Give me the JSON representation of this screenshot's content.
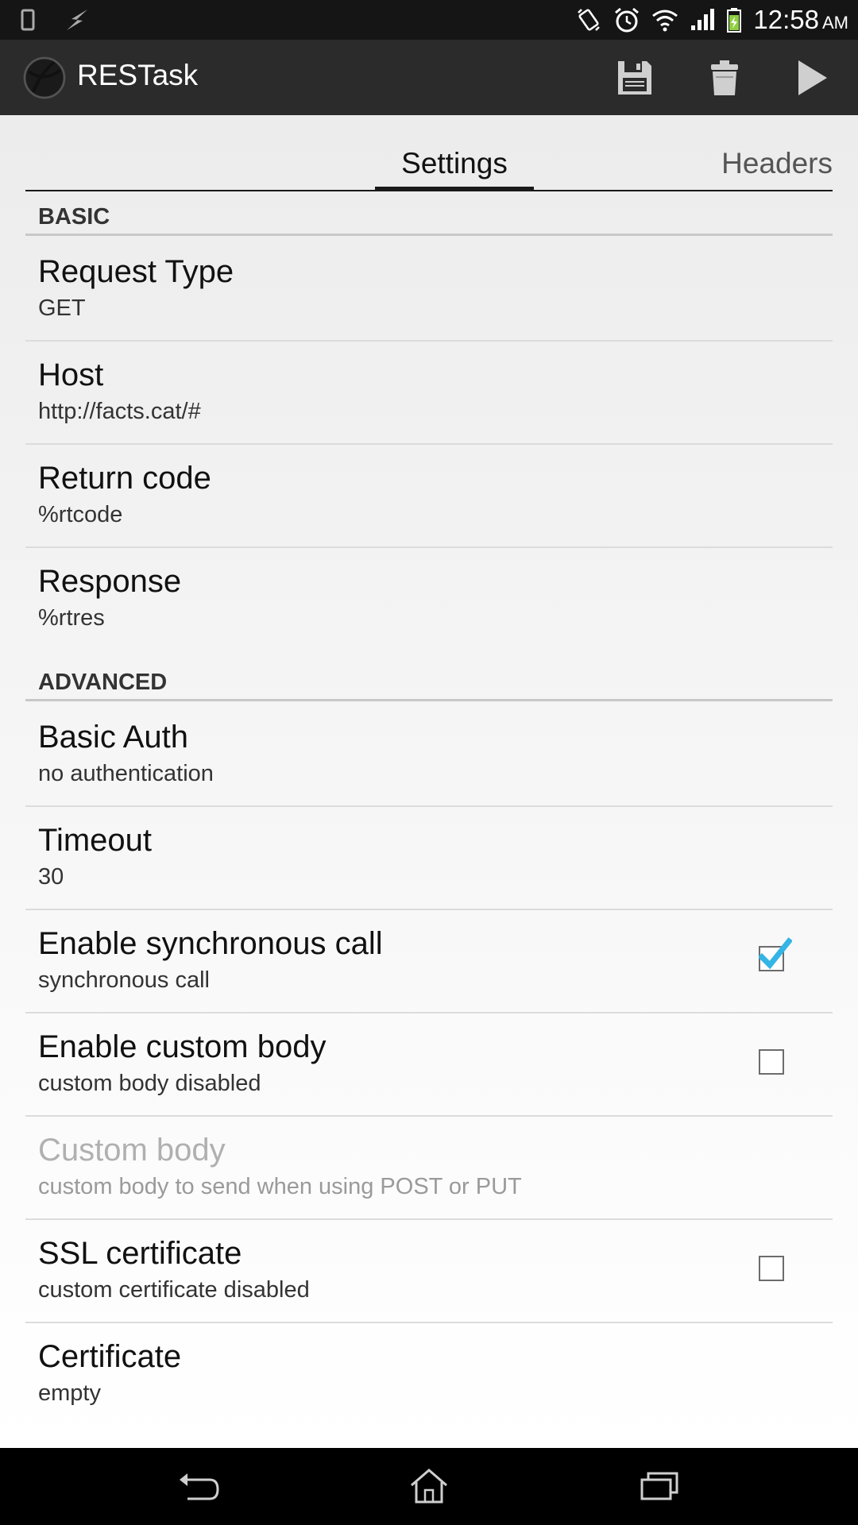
{
  "status_bar": {
    "time": "12:58",
    "ampm": "AM",
    "left_icons": [
      "phone-icon",
      "usb-debug-icon"
    ],
    "right_icons": [
      "vibrate-icon",
      "alarm-icon",
      "wifi-icon",
      "signal-icon",
      "battery-icon"
    ]
  },
  "action_bar": {
    "title": "RESTask",
    "actions": [
      "save-icon",
      "trash-icon",
      "play-icon"
    ]
  },
  "tabs": {
    "settings": "Settings",
    "headers": "Headers",
    "active": "settings"
  },
  "sections": {
    "basic": "BASIC",
    "advanced": "ADVANCED"
  },
  "prefs": {
    "request_type": {
      "title": "Request Type",
      "summary": "GET"
    },
    "host": {
      "title": "Host",
      "summary": "http://facts.cat/#"
    },
    "return_code": {
      "title": "Return code",
      "summary": "%rtcode"
    },
    "response": {
      "title": "Response",
      "summary": "%rtres"
    },
    "basic_auth": {
      "title": "Basic Auth",
      "summary": "no authentication"
    },
    "timeout": {
      "title": "Timeout",
      "summary": "30"
    },
    "sync_call": {
      "title": "Enable synchronous call",
      "summary": "synchronous call",
      "checked": true
    },
    "custom_body_enable": {
      "title": "Enable custom body",
      "summary": "custom body disabled",
      "checked": false
    },
    "custom_body": {
      "title": "Custom body",
      "summary": "custom body to send when using POST or PUT",
      "enabled": false
    },
    "ssl_certificate": {
      "title": "SSL certificate",
      "summary": "custom certificate disabled",
      "checked": false
    },
    "certificate": {
      "title": "Certificate",
      "summary": "empty"
    }
  },
  "colors": {
    "check_accent": "#33b5e5",
    "action_bar_bg": "#2b2b2b",
    "status_bar_bg": "#151515"
  },
  "nav_bar": [
    "back-icon",
    "home-icon",
    "recents-icon"
  ]
}
